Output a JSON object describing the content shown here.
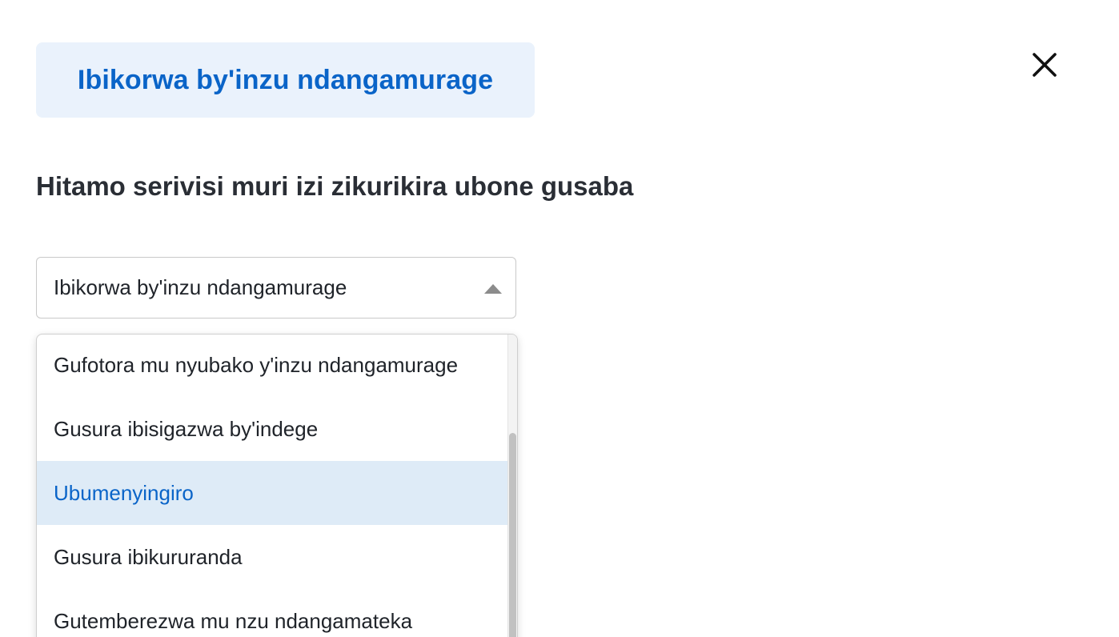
{
  "header": {
    "category_title": "Ibikorwa by'inzu ndangamurage",
    "close_icon": "close-icon"
  },
  "prompt": "Hitamo serivisi muri izi zikurikira ubone gusaba",
  "service_select": {
    "selected_value": "Ibikorwa by'inzu ndangamurage",
    "state": "open",
    "arrow_icon": "caret-up-icon",
    "options": [
      {
        "label": "Gufotora mu nyubako y'inzu ndangamurage",
        "highlighted": false
      },
      {
        "label": "Gusura ibisigazwa by'indege",
        "highlighted": false
      },
      {
        "label": "Ubumenyingiro",
        "highlighted": true
      },
      {
        "label": "Gusura ibikururanda",
        "highlighted": false
      },
      {
        "label": "Gutemberezwa mu nzu ndangamateka",
        "highlighted": false
      }
    ]
  },
  "colors": {
    "accent": "#0a64c8",
    "badge_background": "#eaf2fc",
    "highlight_background": "#deebf7",
    "text": "#2a2e35"
  }
}
